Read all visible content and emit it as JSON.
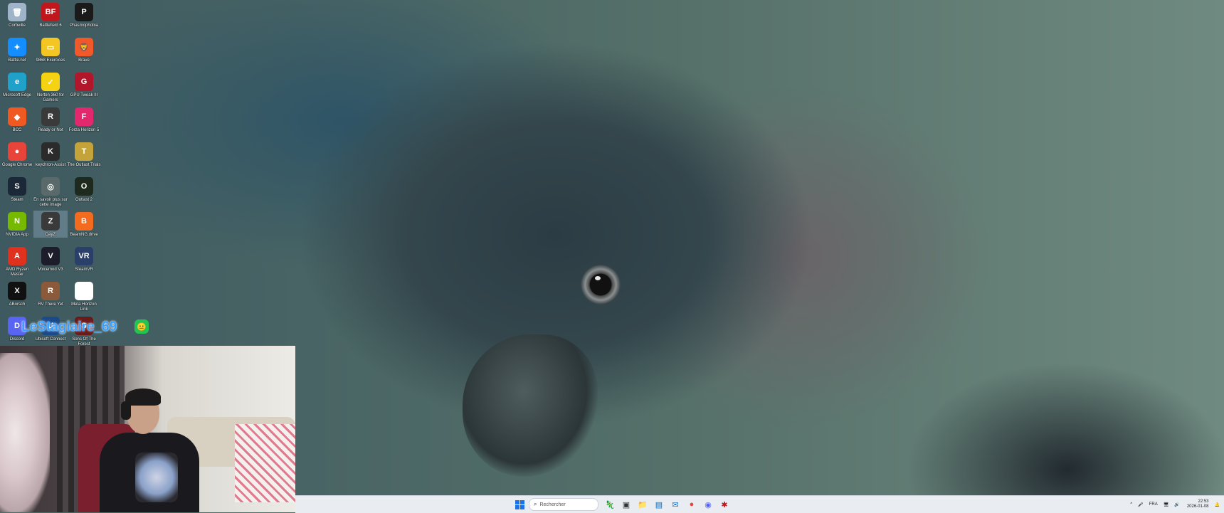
{
  "desktop": {
    "icons": [
      {
        "label": "Corbeille",
        "glyph": "🗑",
        "color": "#9fb4c8"
      },
      {
        "label": "Battlefield 6",
        "glyph": "BF",
        "color": "#c0171d"
      },
      {
        "label": "Phasmophobia",
        "glyph": "P",
        "color": "#1a1a1a"
      },
      {
        "label": "Battle.net",
        "glyph": "✦",
        "color": "#148eff"
      },
      {
        "label": "9868 Exercices",
        "glyph": "▭",
        "color": "#f3c623"
      },
      {
        "label": "Brave",
        "glyph": "🦁",
        "color": "#f1592a"
      },
      {
        "label": "Microsoft Edge",
        "glyph": "e",
        "color": "#1fa1c9"
      },
      {
        "label": "Norton 360 for Gamers",
        "glyph": "✓",
        "color": "#f5d312"
      },
      {
        "label": "GPU Tweak III",
        "glyph": "G",
        "color": "#b1162a"
      },
      {
        "label": "BCC",
        "glyph": "◆",
        "color": "#f05a22"
      },
      {
        "label": "Ready or Not",
        "glyph": "R",
        "color": "#3a3a3a"
      },
      {
        "label": "Forza Horizon 5",
        "glyph": "F",
        "color": "#e4286e"
      },
      {
        "label": "Google Chrome",
        "glyph": "●",
        "color": "#e8443a"
      },
      {
        "label": "keychron-Assist",
        "glyph": "K",
        "color": "#2b2b2b"
      },
      {
        "label": "The Outlast Trials",
        "glyph": "T",
        "color": "#c4a43a"
      },
      {
        "label": "Steam",
        "glyph": "S",
        "color": "#1b2838"
      },
      {
        "label": "En savoir plus sur cette image",
        "glyph": "◎",
        "color": "#5a6a6a"
      },
      {
        "label": "Outlast 2",
        "glyph": "O",
        "color": "#1f2a1f"
      },
      {
        "label": "NVIDIA App",
        "glyph": "N",
        "color": "#76b900"
      },
      {
        "label": "DayZ",
        "glyph": "Z",
        "color": "#3a3a3a"
      },
      {
        "label": "BeamNG.drive",
        "glyph": "B",
        "color": "#f26b1f"
      },
      {
        "label": "AMD Ryzen Master",
        "glyph": "A",
        "color": "#e0301e"
      },
      {
        "label": "Voicemod V3",
        "glyph": "V",
        "color": "#1c1c2a"
      },
      {
        "label": "SteamVR",
        "glyph": "VR",
        "color": "#2b3f6b"
      },
      {
        "label": "ABorsch",
        "glyph": "X",
        "color": "#111111"
      },
      {
        "label": "RV There Yet",
        "glyph": "R",
        "color": "#8a5a3a"
      },
      {
        "label": "Meta Horizon Link",
        "glyph": "∞",
        "color": "#ffffff"
      },
      {
        "label": "Discord",
        "glyph": "D",
        "color": "#5865f2"
      },
      {
        "label": "Ubisoft Connect",
        "glyph": "U",
        "color": "#1a4a8a"
      },
      {
        "label": "Sons Of The Forest",
        "glyph": "S",
        "color": "#6a1a1a"
      }
    ],
    "selected_icon": "DayZ"
  },
  "overlay": {
    "username": "LeStagiaire_69",
    "badge_glyph": "😐"
  },
  "taskbar": {
    "search_placeholder": "Rechercher",
    "apps": [
      {
        "name": "widgets",
        "glyph": "🦎",
        "color": "#6aa84f"
      },
      {
        "name": "task-view",
        "glyph": "▣",
        "color": "#333333"
      },
      {
        "name": "file-explorer",
        "glyph": "📁",
        "color": "#f3c623"
      },
      {
        "name": "store",
        "glyph": "▤",
        "color": "#0067c0"
      },
      {
        "name": "outlook",
        "glyph": "✉",
        "color": "#0f6cbd"
      },
      {
        "name": "chrome",
        "glyph": "●",
        "color": "#e8443a"
      },
      {
        "name": "discord",
        "glyph": "◉",
        "color": "#5865f2"
      },
      {
        "name": "app-red",
        "glyph": "✱",
        "color": "#c0171d"
      }
    ],
    "tray": {
      "chevron": "^",
      "mic": "🎤",
      "language": "FRA",
      "network": "🖥",
      "volume": "🔊",
      "time": "22:53",
      "date": "2026-01-08",
      "notification": "🔔"
    }
  }
}
